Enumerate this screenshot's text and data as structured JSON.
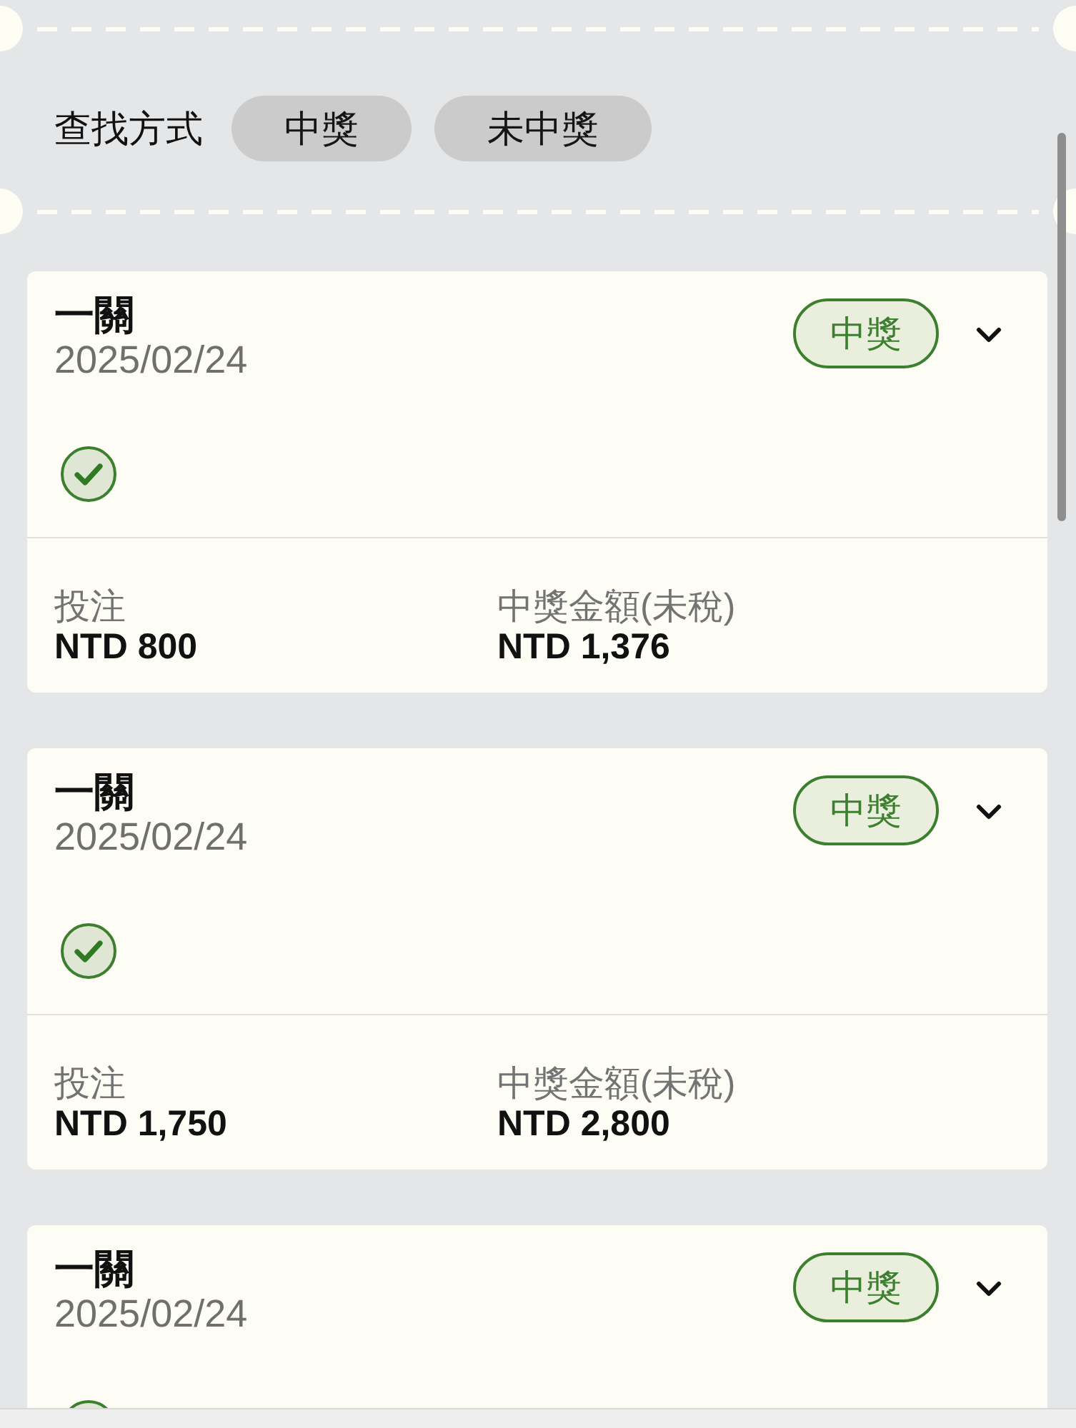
{
  "filter": {
    "label": "查找方式",
    "options": [
      {
        "label": "中獎",
        "selected": false
      },
      {
        "label": "未中獎",
        "selected": false
      }
    ]
  },
  "records": [
    {
      "title": "一關",
      "date": "2025/02/24",
      "badge": "中獎",
      "expanded": false,
      "stake_label": "投注",
      "stake": "NTD 800",
      "payout_label": "中獎金額(未稅)",
      "payout": "NTD 1,376"
    },
    {
      "title": "一關",
      "date": "2025/02/24",
      "badge": "中獎",
      "expanded": false,
      "stake_label": "投注",
      "stake": "NTD 1,750",
      "payout_label": "中獎金額(未稅)",
      "payout": "NTD 2,800"
    },
    {
      "title": "一關",
      "date": "2025/02/24",
      "badge": "中獎",
      "expanded": false
    }
  ]
}
